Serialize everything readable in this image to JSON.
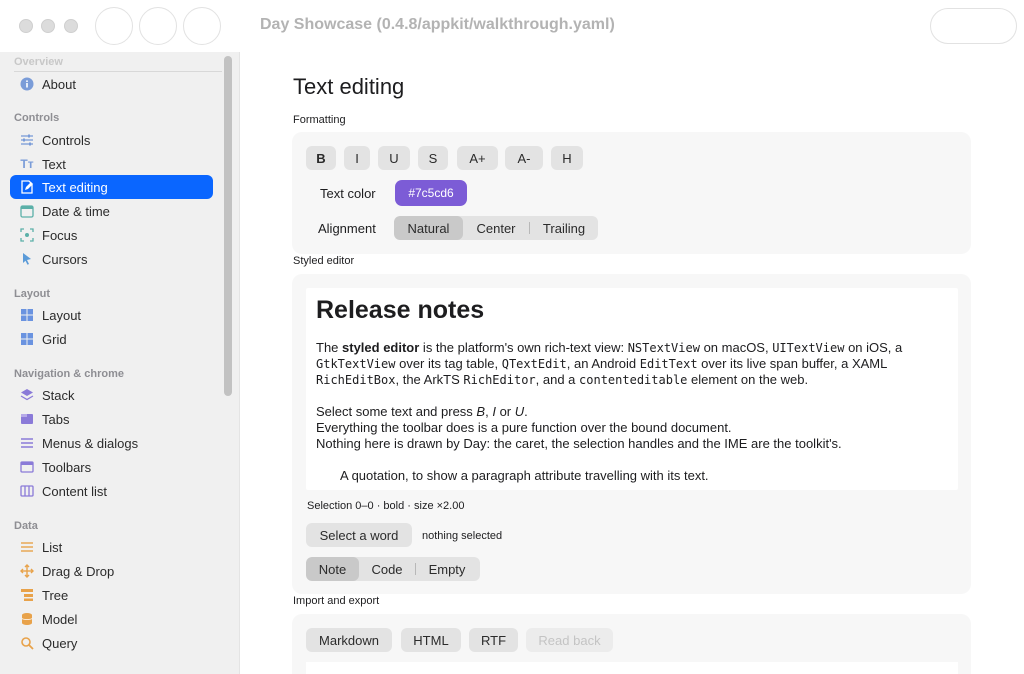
{
  "window": {
    "title": "Day Showcase (0.4.8/appkit/walkthrough.yaml)"
  },
  "sidebar": {
    "sections": [
      {
        "title": "Overview",
        "items": [
          {
            "label": "About",
            "icon": "info-icon"
          }
        ]
      },
      {
        "title": "Controls",
        "items": [
          {
            "label": "Controls",
            "icon": "sliders-icon"
          },
          {
            "label": "Text",
            "icon": "text-icon"
          },
          {
            "label": "Text editing",
            "icon": "edit-icon",
            "selected": true
          },
          {
            "label": "Date & time",
            "icon": "calendar-icon"
          },
          {
            "label": "Focus",
            "icon": "focus-icon"
          },
          {
            "label": "Cursors",
            "icon": "cursor-icon"
          }
        ]
      },
      {
        "title": "Layout",
        "items": [
          {
            "label": "Layout",
            "icon": "layout-icon"
          },
          {
            "label": "Grid",
            "icon": "grid-icon"
          }
        ]
      },
      {
        "title": "Navigation & chrome",
        "items": [
          {
            "label": "Stack",
            "icon": "stack-icon"
          },
          {
            "label": "Tabs",
            "icon": "tabs-icon"
          },
          {
            "label": "Menus & dialogs",
            "icon": "menu-icon"
          },
          {
            "label": "Toolbars",
            "icon": "toolbar-icon"
          },
          {
            "label": "Content list",
            "icon": "columns-icon"
          }
        ]
      },
      {
        "title": "Data",
        "items": [
          {
            "label": "List",
            "icon": "list-icon"
          },
          {
            "label": "Drag & Drop",
            "icon": "move-icon"
          },
          {
            "label": "Tree",
            "icon": "tree-icon"
          },
          {
            "label": "Model",
            "icon": "database-icon"
          },
          {
            "label": "Query",
            "icon": "search-icon"
          }
        ]
      }
    ]
  },
  "main": {
    "title": "Text editing",
    "formatting": {
      "label": "Formatting",
      "buttons": [
        "B",
        "I",
        "U",
        "S",
        "A+",
        "A-",
        "H"
      ],
      "text_color_label": "Text color",
      "text_color_value": "#7c5cd6",
      "alignment_label": "Alignment",
      "alignment_options": [
        "Natural",
        "Center",
        "Trailing"
      ],
      "alignment_selected": "Natural"
    },
    "styled_editor": {
      "label": "Styled editor",
      "heading": "Release notes",
      "p1": {
        "t1": "The ",
        "b1": "styled editor",
        "t2": " is the platform's own rich-text view: ",
        "m1": "NSTextView",
        "t3": " on macOS, ",
        "m2": "UITextView",
        "t4": " on iOS, a ",
        "m3": "GtkTextView",
        "t5": " over its tag table, ",
        "m4": "QTextEdit",
        "t6": ", an Android ",
        "m5": "EditText",
        "t7": " over its live span buffer, a XAML ",
        "m6": "RichEditBox",
        "t8": ", the ArkTS ",
        "m7": "RichEditor",
        "t9": ", and a ",
        "m8": "contenteditable",
        "t10": " element on the web."
      },
      "p2": {
        "t1": "Select some text and press ",
        "i1": "B",
        "t2": ", ",
        "i2": "I",
        "t3": " or ",
        "i3": "U",
        "t4": "."
      },
      "p3": "Everything the toolbar does is a pure function over the bound document.",
      "p4": "Nothing here is drawn by Day: the caret, the selection handles and the IME are the toolkit's.",
      "quote": "A quotation, to show a paragraph attribute travelling with its text.",
      "status": "Selection 0–0 · bold · size ×2.00",
      "select_word_label": "Select a word",
      "selection_status": "nothing selected",
      "modes": [
        "Note",
        "Code",
        "Empty"
      ],
      "mode_selected": "Note"
    },
    "import_export": {
      "label": "Import and export",
      "buttons": [
        "Markdown",
        "HTML",
        "RTF"
      ],
      "read_back_label": "Read back"
    }
  }
}
